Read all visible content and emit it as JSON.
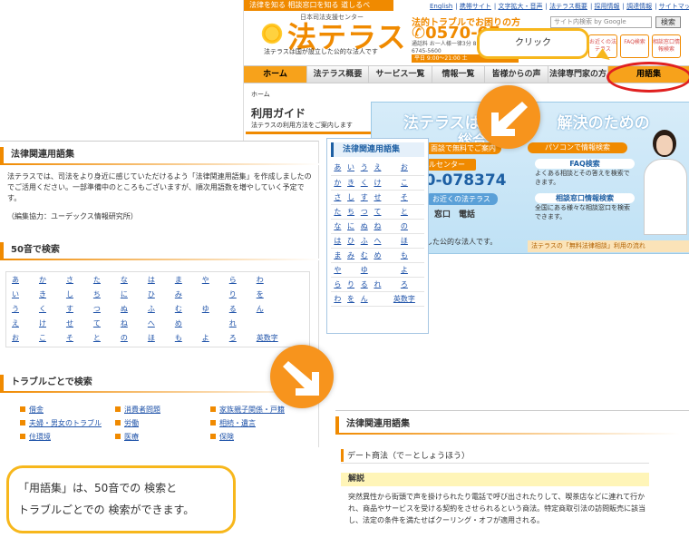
{
  "site": {
    "tagline": "法律を知る 相談窓口を知る 道しるべ",
    "top_links": [
      "English",
      "携帯サイト",
      "文字拡大・音声",
      "法テラス概要",
      "採用情報",
      "調達情報",
      "サイトマップ"
    ],
    "logo_sub": "日本司法支援センター",
    "logo": "法テラス",
    "logo_desc": "法テラスは国が設立した公的な法人です",
    "hotline_title": "法的トラブルでお困りの方",
    "hotline_number": "0570-07",
    "hotline_hours": "通話料 お一人様一律3分 8円/分 IP電話からは03-6745-5600",
    "hotline_bar": "平日 9:00〜21:00 土",
    "search_placeholder": "サイト内検索 by Google",
    "search_button": "検索",
    "mini_buttons": [
      "お近くの法テラス",
      "FAQ検索",
      "相談窓口情報検索"
    ],
    "nav": [
      "ホーム",
      "法テラス概要",
      "サービス一覧",
      "情報一覧",
      "皆様からの声",
      "法律専門家の方",
      "用語集"
    ],
    "breadcrumb": "ホーム",
    "guide_title": "利用ガイド",
    "guide_sub": "法テラスの利用方法をご案内します",
    "banner_h1": "法テラスは、法　　　解決のための",
    "banner_h2": "総合",
    "banner_pill": "ール・面談で無料でご案内",
    "banner_cc": "コールセンター",
    "banner_number": "570-078374",
    "banner_near": "お近くの法テラス",
    "banner_ways": "窓口　電話",
    "banner_est": "が設立した公的な法人です。",
    "banner_pc": "パソコンで情報検索",
    "banner_faq_title": "FAQ検索",
    "banner_faq_text": "よくある相談とその答えを検索できます。",
    "banner_cons_title": "相談窓口情報検索",
    "banner_cons_text": "全国にある様々な相談窓口を検索できます。",
    "banner_foot": "法テラスの「無料法律相談」利用の流れ"
  },
  "callout": {
    "click_label": "クリック"
  },
  "glossary": {
    "title": "法律関連用語集",
    "intro": "法テラスでは、司法をより身近に感じていただけるよう「法律関連用語集」を作成しましたのでご活用ください。一部準備中のところもございますが、順次用語数を増やしていく予定です。",
    "credit": "（編集協力：ユーデックス情報研究所）",
    "kana_title": "50音で検索",
    "kana_rows": [
      [
        "あ",
        "か",
        "さ",
        "た",
        "な",
        "は",
        "ま",
        "や",
        "ら",
        "わ"
      ],
      [
        "い",
        "き",
        "し",
        "ち",
        "に",
        "ひ",
        "み",
        "",
        "り",
        "を"
      ],
      [
        "う",
        "く",
        "す",
        "つ",
        "ぬ",
        "ふ",
        "む",
        "ゆ",
        "る",
        "ん"
      ],
      [
        "え",
        "け",
        "せ",
        "て",
        "ね",
        "へ",
        "め",
        "",
        "れ",
        ""
      ],
      [
        "お",
        "こ",
        "そ",
        "と",
        "の",
        "ほ",
        "も",
        "よ",
        "ろ",
        "英数字"
      ]
    ],
    "trouble_title": "トラブルごとで検索",
    "trouble_rows": [
      [
        "借金",
        "消費者問題",
        "家族親子関係・戸籍"
      ],
      [
        "夫婦・男女のトラブル",
        "労働",
        "相続・遺言"
      ],
      [
        "住環境",
        "医療",
        "保険"
      ]
    ]
  },
  "kana_panel": {
    "title": "法律関連用語集",
    "rows": [
      [
        "あ",
        "い",
        "う",
        "え",
        "お"
      ],
      [
        "か",
        "き",
        "く",
        "け",
        "こ"
      ],
      [
        "さ",
        "し",
        "す",
        "せ",
        "そ"
      ],
      [
        "た",
        "ち",
        "つ",
        "て",
        "と"
      ],
      [
        "な",
        "に",
        "ぬ",
        "ね",
        "の"
      ],
      [
        "は",
        "ひ",
        "ふ",
        "へ",
        "ほ"
      ],
      [
        "ま",
        "み",
        "む",
        "め",
        "も"
      ],
      [
        "や",
        "",
        "ゆ",
        "",
        "よ"
      ],
      [
        "ら",
        "り",
        "る",
        "れ",
        "ろ"
      ],
      [
        "わ",
        "を",
        "ん",
        "",
        "英数字"
      ]
    ]
  },
  "definition": {
    "title": "法律関連用語集",
    "term": "デート商法（で－としょうほう）",
    "explain_label": "解説",
    "body": "突然異性から街頭で声を掛けられたり電話で呼び出されたりして、喫茶店などに連れて行かれ、商品やサービスを受ける契約をさせられるという商法。特定商取引法の訪問販売に該当し、法定の条件を満たせばクーリング・オフが適用される。"
  },
  "caption": {
    "line1": "「用語集」は、50音での 検索と",
    "line2": "トラブルごとでの 検索ができます。"
  },
  "colors": {
    "brand_orange": "#f08a00",
    "callout_yellow": "#f7b71c",
    "highlight_red": "#e02020",
    "arrow_orange": "#f7941d",
    "link_blue": "#2255aa"
  }
}
